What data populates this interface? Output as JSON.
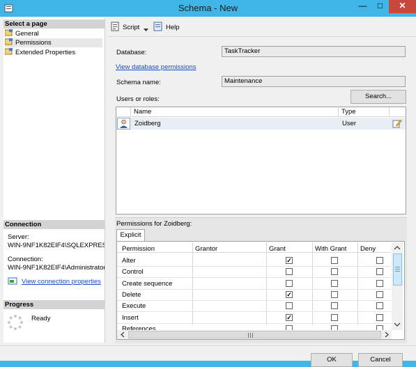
{
  "window": {
    "title": "Schema - New",
    "minimize": "—",
    "maximize": "□",
    "close": "✕"
  },
  "left_pane": {
    "select_page_header": "Select a page",
    "pages": [
      "General",
      "Permissions",
      "Extended Properties"
    ],
    "connection_header": "Connection",
    "server_label": "Server:",
    "server_value": "WIN-9NF1K82EIF4\\SQLEXPRES",
    "connection_label": "Connection:",
    "connection_value": "WIN-9NF1K82EIF4\\Administrator",
    "view_connection_properties": "View connection properties",
    "progress_header": "Progress",
    "progress_status": "Ready"
  },
  "toolbar": {
    "script_label": "Script",
    "help_label": "Help"
  },
  "form": {
    "database_label": "Database:",
    "database_value": "TaskTracker",
    "view_db_permissions": "View database permissions",
    "schema_name_label": "Schema name:",
    "schema_name_value": "Maintenance",
    "users_or_roles_label": "Users or roles:",
    "search_button": "Search..."
  },
  "users_grid": {
    "columns": [
      "Name",
      "Type"
    ],
    "rows": [
      {
        "name": "Zoidberg",
        "type": "User"
      }
    ]
  },
  "permissions": {
    "label": "Permissions for Zoidberg:",
    "tab": "Explicit",
    "columns": [
      "Permission",
      "Grantor",
      "Grant",
      "With Grant",
      "Deny"
    ],
    "rows": [
      {
        "permission": "Alter",
        "grantor": "",
        "grant": true,
        "with_grant": false,
        "deny": false
      },
      {
        "permission": "Control",
        "grantor": "",
        "grant": false,
        "with_grant": false,
        "deny": false
      },
      {
        "permission": "Create sequence",
        "grantor": "",
        "grant": false,
        "with_grant": false,
        "deny": false
      },
      {
        "permission": "Delete",
        "grantor": "",
        "grant": true,
        "with_grant": false,
        "deny": false
      },
      {
        "permission": "Execute",
        "grantor": "",
        "grant": false,
        "with_grant": false,
        "deny": false
      },
      {
        "permission": "Insert",
        "grantor": "",
        "grant": true,
        "with_grant": false,
        "deny": false
      },
      {
        "permission": "References",
        "grantor": "",
        "grant": false,
        "with_grant": false,
        "deny": false
      }
    ],
    "check_glyph": "✓"
  },
  "footer": {
    "ok_button": "OK",
    "cancel_button": "Cancel"
  },
  "colors": {
    "titlebar": "#3fb5e8",
    "close_button": "#c9483c",
    "link": "#1a4bc6"
  }
}
